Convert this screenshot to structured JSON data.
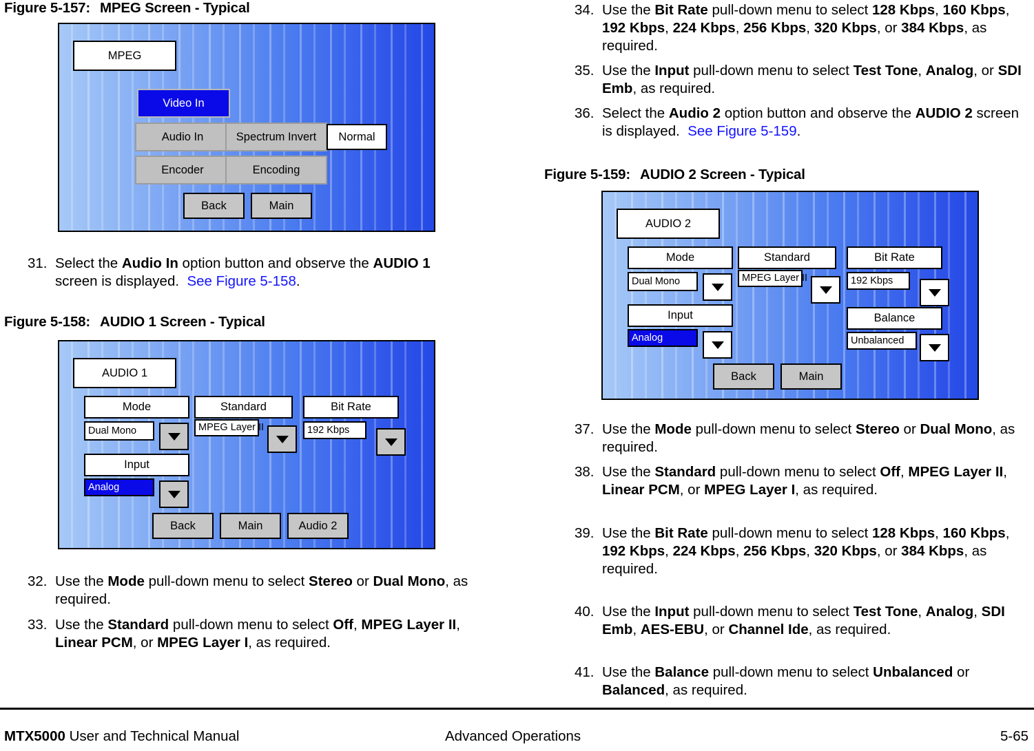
{
  "figures": {
    "mpeg": {
      "caption_number": "Figure 5-157:",
      "caption_title": "MPEG Screen - Typical",
      "title_button": "MPEG",
      "buttons": {
        "video_in": "Video In",
        "audio_in": "Audio In",
        "spectrum_invert": "Spectrum Invert",
        "normal": "Normal",
        "encoder": "Encoder",
        "encoding": "Encoding",
        "back": "Back",
        "main": "Main"
      }
    },
    "audio1": {
      "caption_number": "Figure 5-158:",
      "caption_title": "AUDIO 1 Screen - Typical",
      "title_button": "AUDIO 1",
      "labels": {
        "mode": "Mode",
        "standard": "Standard",
        "bit_rate": "Bit Rate",
        "input": "Input"
      },
      "values": {
        "mode": "Dual Mono",
        "standard": "MPEG Layer II",
        "bit_rate": "192 Kbps",
        "input": "Analog"
      },
      "buttons": {
        "back": "Back",
        "main": "Main",
        "audio2": "Audio 2"
      }
    },
    "audio2": {
      "caption_number": "Figure 5-159:",
      "caption_title": "AUDIO 2 Screen - Typical",
      "title_button": "AUDIO 2",
      "labels": {
        "mode": "Mode",
        "standard": "Standard",
        "bit_rate": "Bit Rate",
        "input": "Input",
        "balance": "Balance"
      },
      "values": {
        "mode": "Dual Mono",
        "standard": "MPEG Layer II",
        "bit_rate": "192 Kbps",
        "input": "Analog",
        "balance": "Unbalanced"
      },
      "buttons": {
        "back": "Back",
        "main": "Main"
      }
    }
  },
  "steps": {
    "s31": {
      "num": "31.",
      "html": "Select the <b>Audio In</b> option button and observe the <b>AUDIO 1</b> screen is displayed.&nbsp; <span class=\"xref\">See Figure 5-158</span>."
    },
    "s32": {
      "num": "32.",
      "html": "Use the <b>Mode</b> pull-down menu to select <b>Stereo</b> or <b>Dual Mono</b>, as required."
    },
    "s33": {
      "num": "33.",
      "html": "Use the <b>Standard</b> pull-down menu to select <b>Off</b>, <b>MPEG Layer II</b>, <b>Linear PCM</b>, or <b>MPEG Layer I</b>, as required."
    },
    "s34": {
      "num": "34.",
      "html": "Use the <b>Bit Rate</b> pull-down menu to select <b>128 Kbps</b>, <b>160 Kbps</b>, <b>192 Kbps</b>, <b>224 Kbps</b>, <b>256 Kbps</b>, <b>320 Kbps</b>, or <b>384 Kbps</b>, as required."
    },
    "s35": {
      "num": "35.",
      "html": "Use the <b>Input</b> pull-down menu to select <b>Test Tone</b>, <b>Analog</b>, or <b>SDI Emb</b>, as required."
    },
    "s36": {
      "num": "36.",
      "html": "Select the <b>Audio 2</b> option button and observe the <b>AUDIO 2</b> screen is displayed.&nbsp; <span class=\"xref\">See Figure 5-159</span>."
    },
    "s37": {
      "num": "37.",
      "html": "Use the <b>Mode</b> pull-down menu to select <b>Stereo</b> or <b>Dual Mono</b>, as required."
    },
    "s38": {
      "num": "38.",
      "html": "Use the <b>Standard</b> pull-down menu to select <b>Off</b>, <b>MPEG Layer II</b>, <b>Linear PCM</b>, or <b>MPEG Layer I</b>, as required."
    },
    "s39": {
      "num": "39.",
      "html": "Use the <b>Bit Rate</b> pull-down menu to select <b>128 Kbps</b>, <b>160 Kbps</b>, <b>192 Kbps</b>, <b>224 Kbps</b>, <b>256 Kbps</b>, <b>320 Kbps</b>, or <b>384 Kbps</b>, as required."
    },
    "s40": {
      "num": "40.",
      "html": "Use the <b>Input</b> pull-down menu to select <b>Test Tone</b>, <b>Analog</b>, <b>SDI Emb</b>, <b>AES-EBU</b>, or <b>Channel Ide</b>, as required."
    },
    "s41": {
      "num": "41.",
      "html": "Use the <b>Balance</b> pull-down menu to select <b>Unbalanced</b> or <b>Balanced</b>, as required."
    }
  },
  "footer": {
    "manual_bold": "MTX5000",
    "manual_rest": " User and Technical Manual",
    "section": "Advanced Operations",
    "page": "5-65"
  },
  "colors": {
    "screen_gradient_start": "#a6c9f7",
    "screen_gradient_end": "#2449e6",
    "selected_blue": "#0a0ae8",
    "button_gray": "#c6c6c6",
    "xref_blue": "#1414ff"
  }
}
